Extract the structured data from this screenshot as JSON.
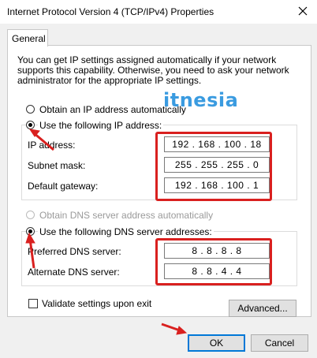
{
  "window": {
    "title": "Internet Protocol Version 4 (TCP/IPv4) Properties",
    "close_icon": "close-icon"
  },
  "tabs": [
    {
      "label": "General",
      "selected": true
    }
  ],
  "description": "You can get IP settings assigned automatically if your network supports this capability. Otherwise, you need to ask your network administrator for the appropriate IP settings.",
  "watermark": "itnesia",
  "ip": {
    "auto_label": "Obtain an IP address automatically",
    "manual_label": "Use the following IP address:",
    "selected": "manual",
    "fields": [
      {
        "label": "IP address:",
        "value": "192 . 168 . 100 . 18"
      },
      {
        "label": "Subnet mask:",
        "value": "255 . 255 . 255 . 0"
      },
      {
        "label": "Default gateway:",
        "value": "192 . 168 . 100 . 1"
      }
    ]
  },
  "dns": {
    "auto_label": "Obtain DNS server address automatically",
    "auto_disabled": true,
    "manual_label": "Use the following DNS server addresses:",
    "selected": "manual",
    "fields": [
      {
        "label": "Preferred DNS server:",
        "value": "8 . 8 . 8 . 8"
      },
      {
        "label": "Alternate DNS server:",
        "value": "8 . 8 . 4 . 4"
      }
    ]
  },
  "validate_label": "Validate settings upon exit",
  "validate_checked": false,
  "advanced_label": "Advanced...",
  "ok_label": "OK",
  "cancel_label": "Cancel",
  "colors": {
    "highlight": "#d9201f",
    "accent": "#0078d7"
  }
}
